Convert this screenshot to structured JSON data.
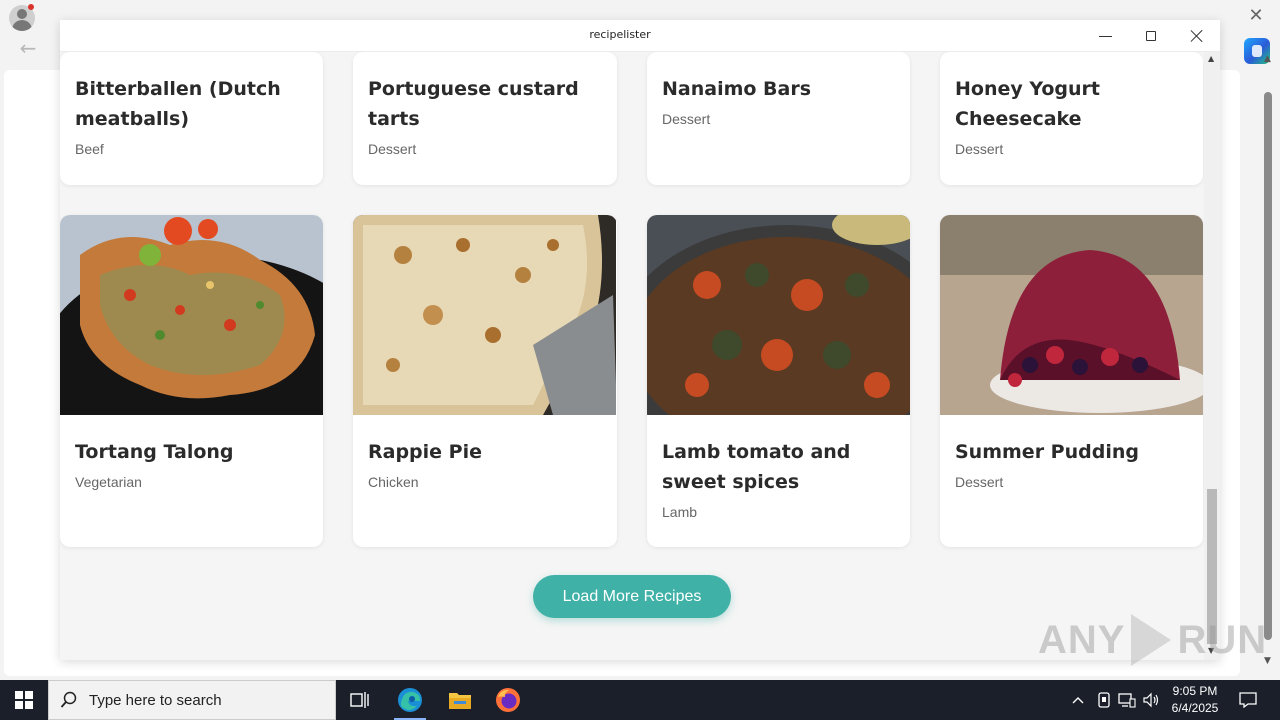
{
  "window": {
    "title": "recipelister"
  },
  "recipes_row1": [
    {
      "title": "Bitterballen (Dutch meatballs)",
      "category": "Beef"
    },
    {
      "title": "Portuguese custard tarts",
      "category": "Dessert"
    },
    {
      "title": "Nanaimo Bars",
      "category": "Dessert"
    },
    {
      "title": "Honey Yogurt Cheesecake",
      "category": "Dessert"
    }
  ],
  "recipes_row2": [
    {
      "title": "Tortang Talong",
      "category": "Vegetarian"
    },
    {
      "title": "Rappie Pie",
      "category": "Chicken"
    },
    {
      "title": "Lamb tomato and sweet spices",
      "category": "Lamb"
    },
    {
      "title": "Summer Pudding",
      "category": "Dessert"
    }
  ],
  "load_more_label": "Load More Recipes",
  "taskbar": {
    "search_placeholder": "Type here to search",
    "time": "9:05 PM",
    "date": "6/4/2025"
  },
  "watermark": {
    "text_left": "ANY",
    "text_right": "RUN"
  },
  "colors": {
    "accent": "#3fb1a7",
    "taskbar": "#1a1f29"
  }
}
